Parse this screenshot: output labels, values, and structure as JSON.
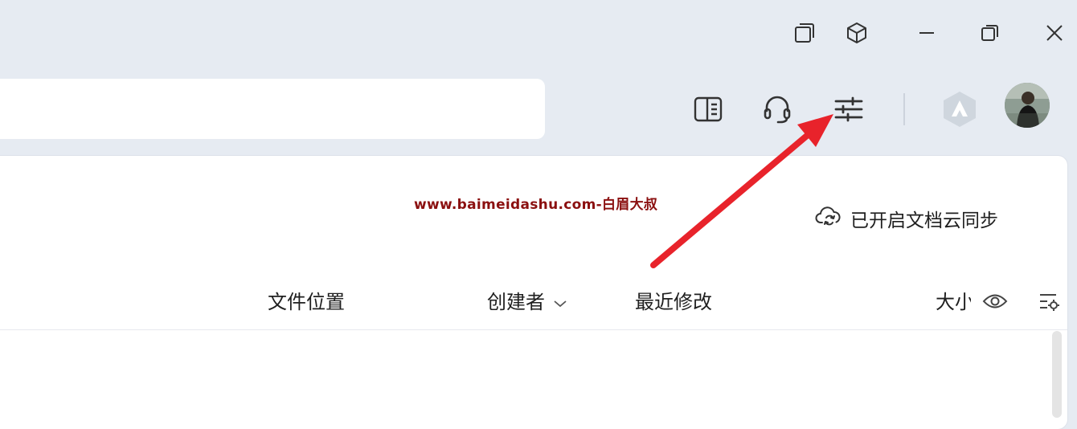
{
  "window": {
    "buttons": [
      {
        "name": "window-tiles-icon"
      },
      {
        "name": "cube-icon"
      },
      {
        "name": "minimize-icon"
      },
      {
        "name": "restore-icon"
      },
      {
        "name": "close-icon"
      }
    ]
  },
  "search": {
    "placeholder": "",
    "value": ""
  },
  "toolbar": {
    "icons": [
      "reader-panel-icon",
      "headset-icon",
      "sliders-icon",
      "app-logo-icon",
      "user-avatar"
    ]
  },
  "watermark": {
    "text": "www.baimeidashu.com-白眉大叔"
  },
  "sync": {
    "label": "已开启文档云同步",
    "icon": "cloud-sync-icon"
  },
  "table": {
    "columns": {
      "location": "文件位置",
      "creator": "创建者",
      "modified": "最近修改",
      "size": "大小"
    },
    "column_icons": [
      "chevron-down-icon",
      "eye-icon",
      "column-settings-icon"
    ]
  },
  "colors": {
    "background": "#e6ebf2",
    "panel": "#ffffff",
    "watermark": "#8b1010",
    "arrow": "#e8232b"
  }
}
